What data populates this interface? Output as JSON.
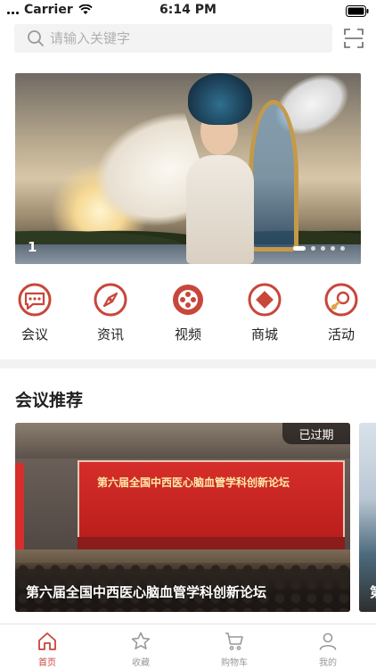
{
  "status_bar": {
    "carrier": "Carrier",
    "time": "6:14 PM"
  },
  "search": {
    "placeholder": "请输入关键字"
  },
  "banner": {
    "index": "1",
    "dots": 5,
    "active_dot": 0
  },
  "categories": [
    {
      "label": "会议",
      "icon": "meeting-icon"
    },
    {
      "label": "资讯",
      "icon": "compass-icon"
    },
    {
      "label": "视频",
      "icon": "film-reel-icon"
    },
    {
      "label": "商城",
      "icon": "diamond-icon"
    },
    {
      "label": "活动",
      "icon": "rocket-icon"
    }
  ],
  "section": {
    "title": "会议推荐"
  },
  "conferences": [
    {
      "title": "第六届全国中西医心脑血管学科创新论坛",
      "status": "已过期",
      "screen_text": "第六届全国中西医心脑血管学科创新论坛"
    },
    {
      "title": "第"
    }
  ],
  "tabbar": [
    {
      "label": "首页",
      "icon": "home-icon",
      "active": true
    },
    {
      "label": "收藏",
      "icon": "star-icon",
      "active": false
    },
    {
      "label": "购物车",
      "icon": "cart-icon",
      "active": false
    },
    {
      "label": "我的",
      "icon": "user-icon",
      "active": false
    }
  ],
  "colors": {
    "accent": "#c8463a",
    "inactive": "#999999",
    "search_bg": "#f3f3f3"
  }
}
